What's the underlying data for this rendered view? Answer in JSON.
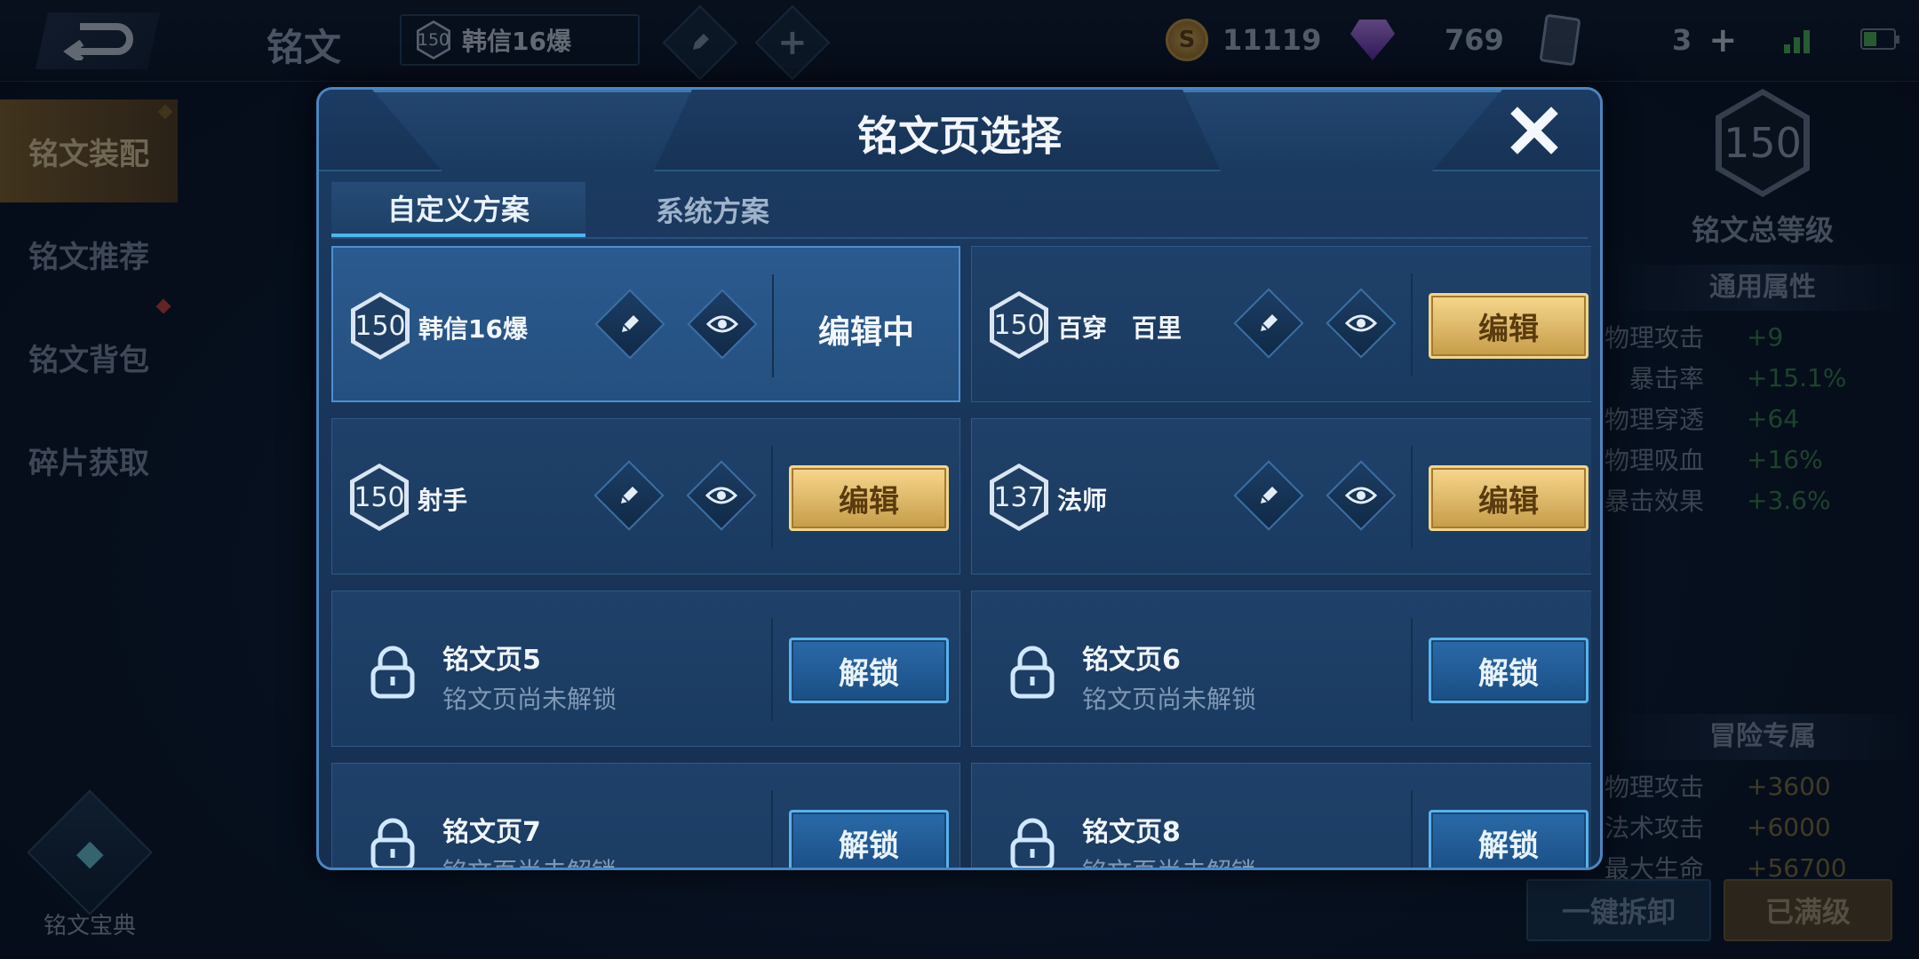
{
  "topbar": {
    "title": "铭文",
    "hero_chip": {
      "level": "150",
      "name": "韩信16爆"
    },
    "currencies": [
      {
        "icon": "gold-coin-icon",
        "value": "11119"
      },
      {
        "icon": "diamond-icon",
        "value": "769"
      },
      {
        "icon": "card-icon",
        "value": "3"
      }
    ]
  },
  "leftnav": {
    "items": [
      {
        "label": "铭文装配",
        "active": true
      },
      {
        "label": "铭文推荐",
        "active": false
      },
      {
        "label": "铭文背包",
        "active": false
      },
      {
        "label": "碎片获取",
        "active": false
      }
    ],
    "codex_label": "铭文宝典"
  },
  "rightpanel": {
    "total_level": "150",
    "total_level_label": "铭文总等级",
    "general_header": "通用属性",
    "general_stats": [
      {
        "k": "物理攻击",
        "v": "+9"
      },
      {
        "k": "暴击率",
        "v": "+15.1%"
      },
      {
        "k": "物理穿透",
        "v": "+64"
      },
      {
        "k": "物理吸血",
        "v": "+16%"
      },
      {
        "k": "暴击效果",
        "v": "+3.6%"
      }
    ],
    "adventure_header": "冒险专属",
    "adventure_stats": [
      {
        "k": "物理攻击",
        "v": "+3600"
      },
      {
        "k": "法术攻击",
        "v": "+6000"
      },
      {
        "k": "最大生命",
        "v": "+56700"
      }
    ],
    "dismantle_label": "一键拆卸",
    "maxed_label": "已满级"
  },
  "modal": {
    "title": "铭文页选择",
    "tabs": [
      "自定义方案",
      "系统方案"
    ],
    "pages": [
      {
        "level": "150",
        "name": "韩信16爆",
        "status": "编辑中"
      },
      {
        "level": "150",
        "name": "百穿　百里",
        "button": "编辑"
      },
      {
        "level": "150",
        "name": "射手",
        "button": "编辑"
      },
      {
        "level": "137",
        "name": "法师",
        "button": "编辑"
      }
    ],
    "locked_pages": [
      {
        "name": "铭文页5",
        "sub": "铭文页尚未解锁",
        "button": "解锁"
      },
      {
        "name": "铭文页6",
        "sub": "铭文页尚未解锁",
        "button": "解锁"
      },
      {
        "name": "铭文页7",
        "sub": "铭文页尚未解锁",
        "button": "解锁"
      },
      {
        "name": "铭文页8",
        "sub": "铭文页尚未解锁",
        "button": "解锁"
      }
    ]
  }
}
